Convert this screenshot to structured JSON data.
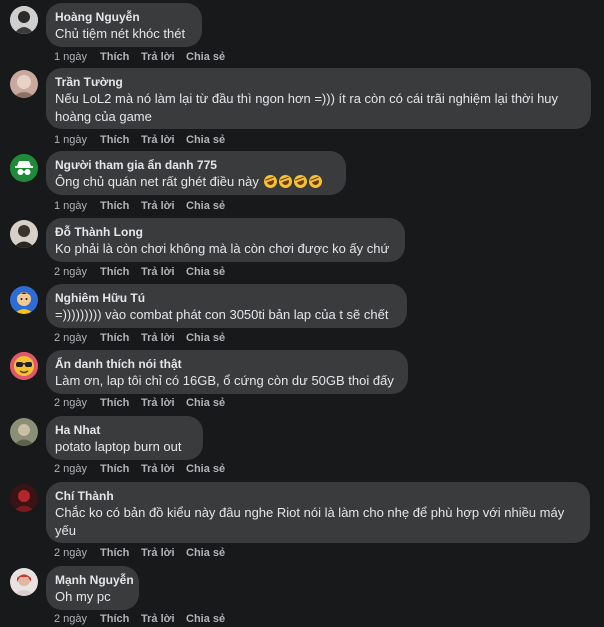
{
  "actions": {
    "like": "Thích",
    "reply": "Trả lời",
    "share": "Chia sẻ"
  },
  "comments": [
    {
      "author": "Hoàng Nguyễn",
      "text": "Chủ tiệm nét khóc thét",
      "time": "1 ngày",
      "avatar": "person-avatar"
    },
    {
      "author": "Trần Tường",
      "text": "Nếu LoL2 mà nó làm lại từ đầu thì ngon hơn =))) ít ra còn có cái trãi nghiệm lại thời huy hoàng của game",
      "time": "1 ngày",
      "avatar": "person-avatar"
    },
    {
      "author": "Người tham gia ẩn danh 775",
      "text": "Ông chủ quán net rất ghét điều này",
      "time": "1 ngày",
      "avatar": "anonymous-avatar",
      "emoji_count": 4
    },
    {
      "author": "Đỗ Thành Long",
      "text": "Ko phải là còn chơi không mà là còn chơi được ko ấy chứ",
      "time": "2 ngày",
      "avatar": "person-avatar"
    },
    {
      "author": "Nghiêm Hữu Tú",
      "text": "=))))))))) vào combat phát con 3050ti bản lap của t sẽ chết",
      "time": "2 ngày",
      "avatar": "cartoon-avatar"
    },
    {
      "author": "Ẩn danh thích nói thật",
      "text": "Làm ơn, lap tôi chỉ có 16GB, ổ cứng còn dư 50GB thoi đấy",
      "time": "2 ngày",
      "avatar": "sunglasses-emoji-avatar"
    },
    {
      "author": "Ha Nhat",
      "text": "potato laptop burn out",
      "time": "2 ngày",
      "avatar": "person-avatar"
    },
    {
      "author": "Chí Thành",
      "text": "Chắc ko có bản đồ kiểu này đâu nghe Riot nói là làm cho nhẹ để phù hợp với nhiều máy yếu",
      "time": "2 ngày",
      "avatar": "person-avatar"
    },
    {
      "author": "Mạnh Nguyễn",
      "text": "Oh my pc",
      "time": "2 ngày",
      "avatar": "person-avatar"
    }
  ]
}
